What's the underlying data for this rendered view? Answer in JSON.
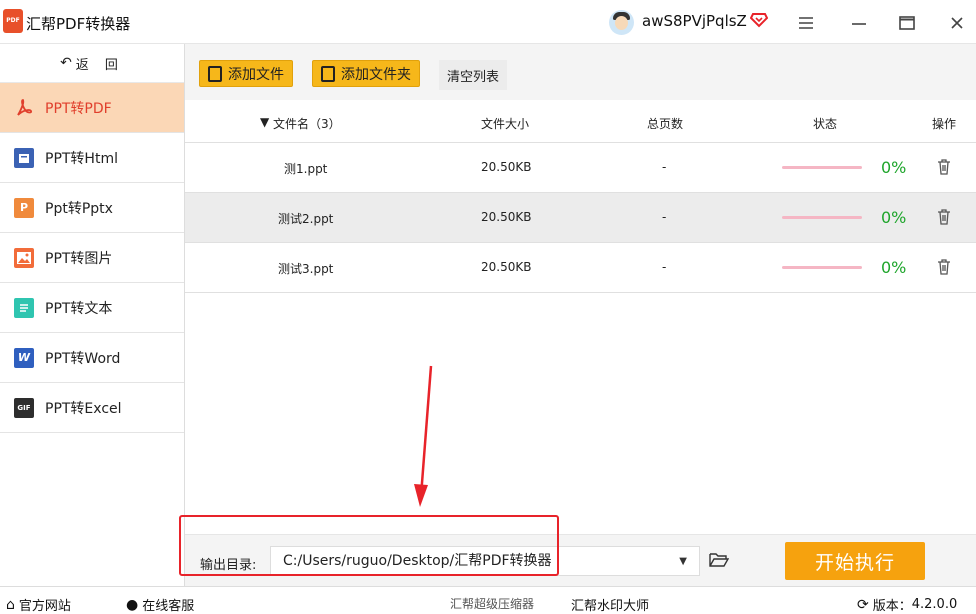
{
  "app": {
    "title": "汇帮PDF转换器",
    "logo_text": "PDF",
    "username": "awS8PVjPqlsZ"
  },
  "sidebar": {
    "back_label": "返 回",
    "items": [
      {
        "label": "PPT转PDF",
        "icon": "pdf-icon",
        "active": true
      },
      {
        "label": "PPT转Html",
        "icon": "html-icon"
      },
      {
        "label": "Ppt转Pptx",
        "icon": "pptx-icon"
      },
      {
        "label": "PPT转图片",
        "icon": "image-icon"
      },
      {
        "label": "PPT转文本",
        "icon": "text-icon"
      },
      {
        "label": "PPT转Word",
        "icon": "word-icon"
      },
      {
        "label": "PPT转Excel",
        "icon": "excel-icon"
      }
    ]
  },
  "toolbar": {
    "add_file": "添加文件",
    "add_folder": "添加文件夹",
    "clear_list": "清空列表"
  },
  "table": {
    "headers": {
      "filename": "文件名（3）",
      "size": "文件大小",
      "pages": "总页数",
      "status": "状态",
      "action": "操作"
    },
    "rows": [
      {
        "name": "测1.ppt",
        "size": "20.50KB",
        "pages": "-",
        "progress_text": "0%",
        "progress": 0
      },
      {
        "name": "测试2.ppt",
        "size": "20.50KB",
        "pages": "-",
        "progress_text": "0%",
        "progress": 0
      },
      {
        "name": "测试3.ppt",
        "size": "20.50KB",
        "pages": "-",
        "progress_text": "0%",
        "progress": 0
      }
    ]
  },
  "output": {
    "label": "输出目录:",
    "path": "C:/Users/ruguo/Desktop/汇帮PDF转换器",
    "start": "开始执行"
  },
  "statusbar": {
    "website": "官方网站",
    "support": "在线客服",
    "compressor": "汇帮超级压缩器",
    "watermark": "汇帮水印大师",
    "version_label": "版本：",
    "version": "4.2.0.0"
  },
  "colors": {
    "accent": "#f6b71a",
    "start": "#f6a20e",
    "active_bg": "#fbd7b6",
    "active_text": "#e03f2c",
    "progress_text": "#1ea52b",
    "annotation": "#e8232a"
  }
}
